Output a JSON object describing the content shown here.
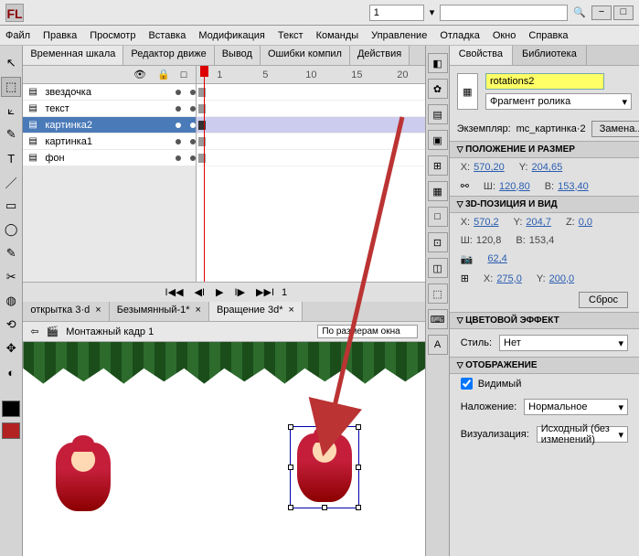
{
  "title": {
    "logo": "FL",
    "workspace": "1"
  },
  "winbtns": {
    "min": "−",
    "max": "□",
    "close": ""
  },
  "menu": [
    "Файл",
    "Правка",
    "Просмотр",
    "Вставка",
    "Модификация",
    "Текст",
    "Команды",
    "Управление",
    "Отладка",
    "Окно",
    "Справка"
  ],
  "timeline": {
    "tabs": [
      "Временная шкала",
      "Редактор движе",
      "Вывод",
      "Ошибки компил",
      "Действия"
    ],
    "ruler": [
      "1",
      "5",
      "10",
      "15",
      "20"
    ],
    "layers": [
      {
        "name": "звездочка",
        "color": "#c080c0"
      },
      {
        "name": "текст",
        "color": "#80c080"
      },
      {
        "name": "картинка2",
        "color": "#e89038",
        "selected": true
      },
      {
        "name": "картинка1",
        "color": "#8080d0"
      },
      {
        "name": "фон",
        "color": "#60b060"
      }
    ],
    "controls": {
      "rewind": "I◀◀",
      "back": "◀I",
      "play": "▶",
      "fwd": "I▶",
      "end": "▶▶I",
      "frame": "1"
    }
  },
  "docs": [
    {
      "name": "открытка 3·d",
      "close": "×"
    },
    {
      "name": "Безымянный-1*",
      "close": "×"
    },
    {
      "name": "Вращение 3d*",
      "close": "×",
      "active": true
    }
  ],
  "stage": {
    "scene_icon": "⇦",
    "scene": "Монтажный кадр 1",
    "zoom": "По размерам окна"
  },
  "props": {
    "tabs": {
      "properties": "Свойства",
      "library": "Библиотека"
    },
    "instance_name": "rotations2",
    "type": "Фрагмент ролика",
    "type_arrow": "▾",
    "instance_label": "Экземпляр:",
    "instance_value": "mc_картинка·2",
    "swap": "Замена...",
    "sections": {
      "position": "ПОЛОЖЕНИЕ И РАЗМЕР",
      "pos3d": "3D-ПОЗИЦИЯ И ВИД",
      "color": "ЦВЕТОВОЙ ЭФФЕКТ",
      "display": "ОТОБРАЖЕНИЕ"
    },
    "position": {
      "x_l": "X:",
      "x": "570,20",
      "y_l": "Y:",
      "y": "204,65",
      "w_l": "Ш:",
      "w": "120,80",
      "h_l": "В:",
      "h": "153,40"
    },
    "pos3d": {
      "x_l": "X:",
      "x": "570,2",
      "y_l": "Y:",
      "y": "204,7",
      "z_l": "Z:",
      "z": "0,0",
      "w_l": "Ш:",
      "w": "120,8",
      "h_l": "В:",
      "h": "153,4",
      "persp": "62,4",
      "vx_l": "X:",
      "vx": "275,0",
      "vy_l": "Y:",
      "vy": "200,0",
      "reset": "Сброс"
    },
    "color_style": {
      "label": "Стиль:",
      "value": "Нет",
      "arrow": "▾"
    },
    "display": {
      "visible": "Видимый",
      "blend_label": "Наложение:",
      "blend": "Нормальное",
      "arrow": "▾",
      "render_label": "Визуализация:",
      "render": "Исходный (без изменений)"
    }
  },
  "rtools": [
    "◧",
    "✿",
    "▤",
    "▣",
    "⊞",
    "▦",
    "□",
    "⊡",
    "◫",
    "⬚",
    "⌨",
    "A"
  ],
  "ltools": [
    "↖",
    "⬚",
    "⟀",
    "✎",
    "T",
    "／",
    "▭",
    "◯",
    "✎",
    "✂",
    "◍",
    "⟲",
    "✥",
    "◐"
  ]
}
